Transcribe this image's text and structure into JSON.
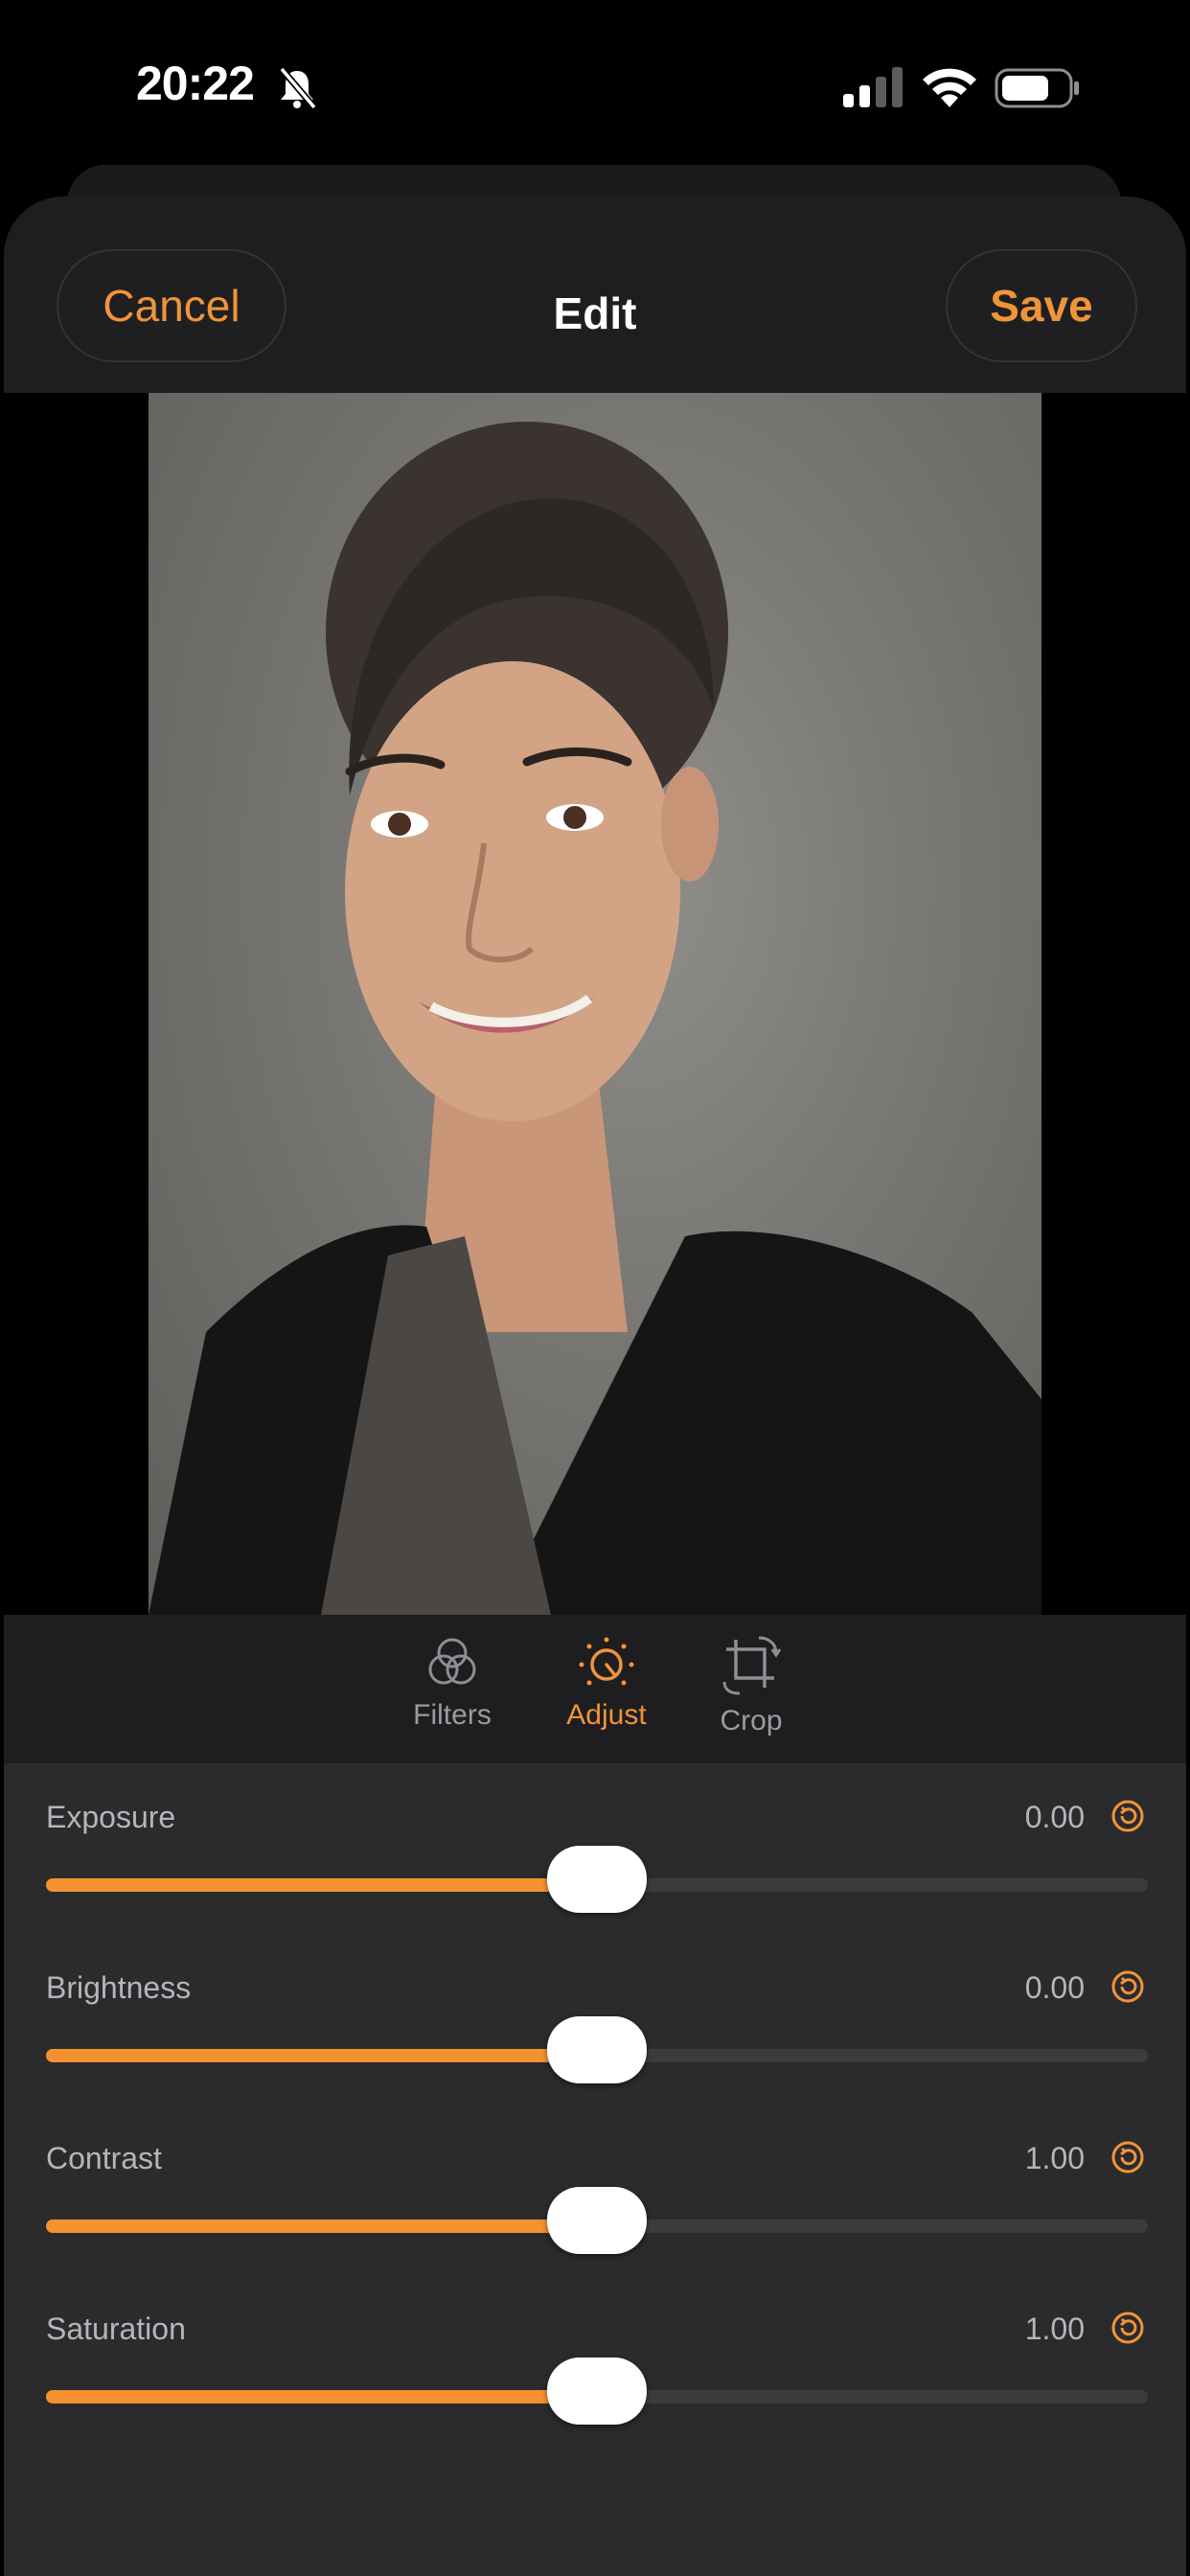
{
  "status_bar": {
    "time": "20:22"
  },
  "nav": {
    "cancel_label": "Cancel",
    "title": "Edit",
    "save_label": "Save"
  },
  "tabs": [
    {
      "label": "Filters",
      "icon": "filters-icon",
      "active": false
    },
    {
      "label": "Adjust",
      "icon": "adjust-icon",
      "active": true
    },
    {
      "label": "Crop",
      "icon": "crop-icon",
      "active": false
    }
  ],
  "adjustments": [
    {
      "label": "Exposure",
      "value": "0.00",
      "level": 0.5
    },
    {
      "label": "Brightness",
      "value": "0.00",
      "level": 0.5
    },
    {
      "label": "Contrast",
      "value": "1.00",
      "level": 0.5
    },
    {
      "label": "Saturation",
      "value": "1.00",
      "level": 0.5
    }
  ],
  "colors": {
    "accent": "#f0943a",
    "background": "#000000",
    "sheet": "#1e1e20",
    "panel": "#2b2b2d"
  }
}
